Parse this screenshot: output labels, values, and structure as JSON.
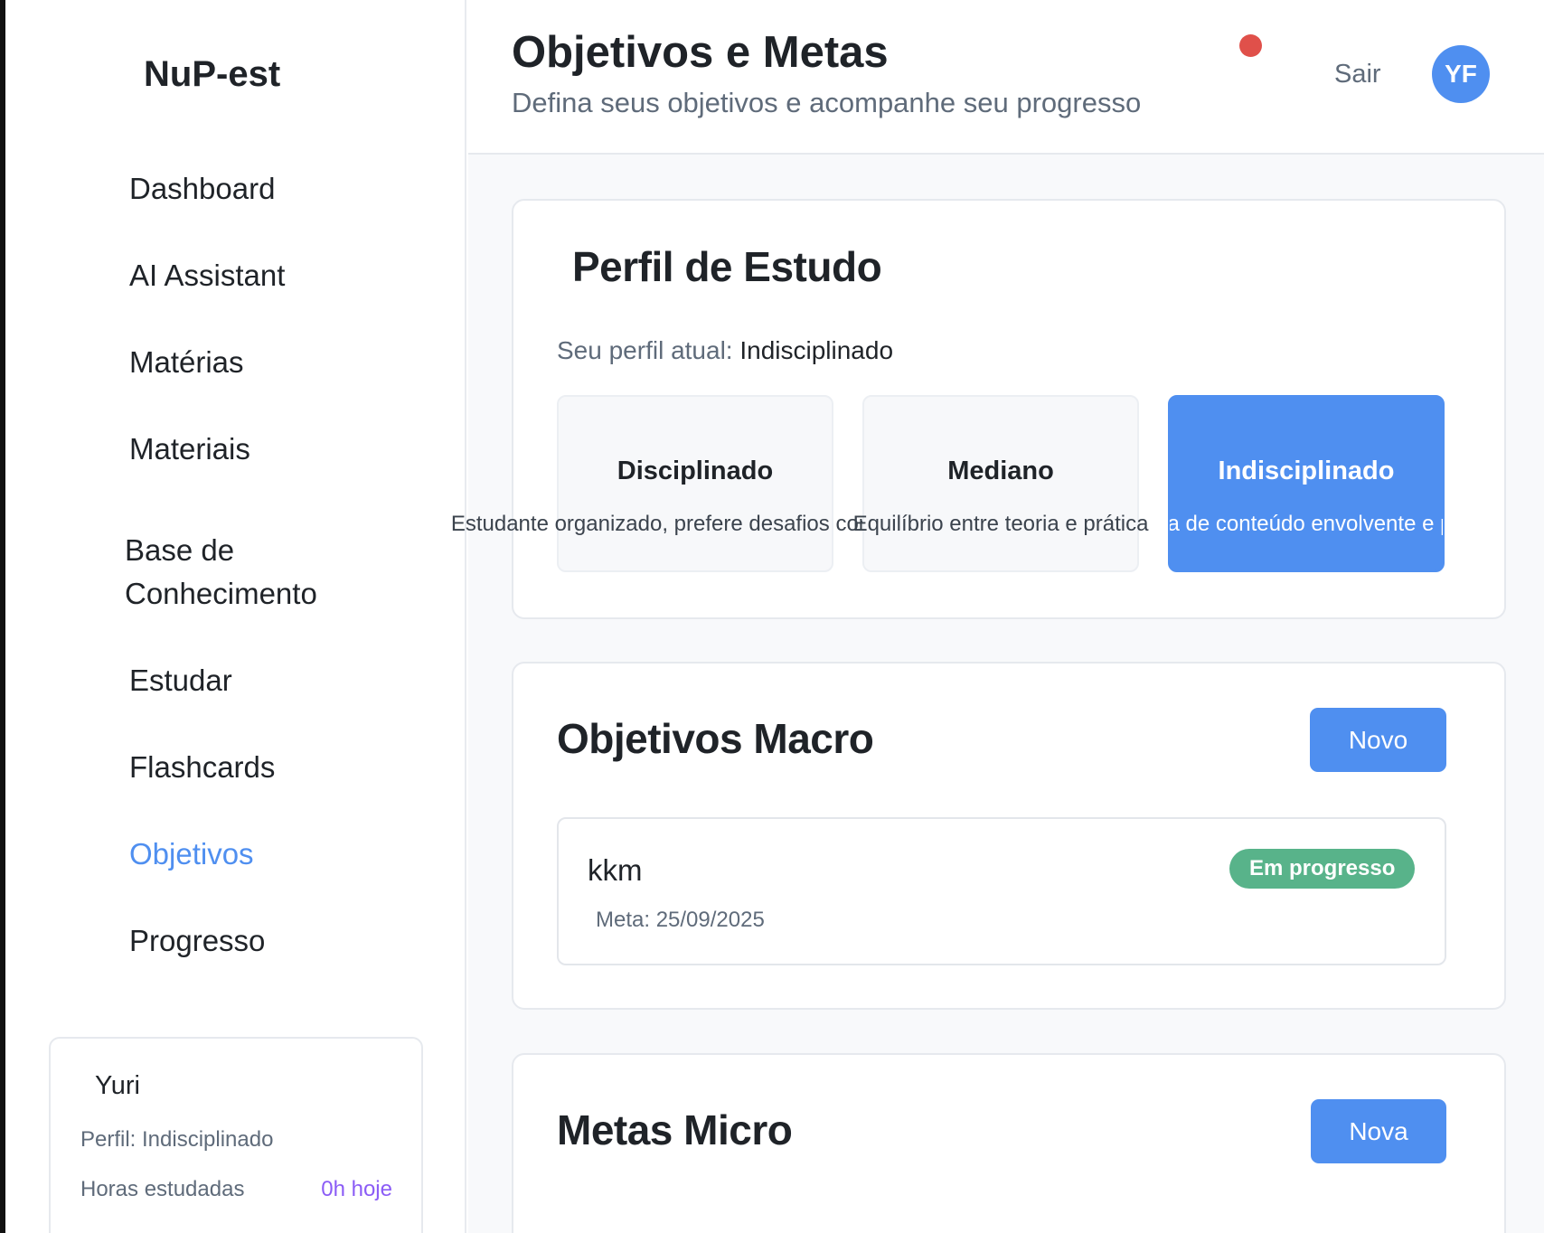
{
  "sidebar": {
    "brand": "NuP-est",
    "items": [
      {
        "label": "Dashboard",
        "active": false
      },
      {
        "label": "AI Assistant",
        "active": false
      },
      {
        "label": "Matérias",
        "active": false
      },
      {
        "label": "Materiais",
        "active": false
      },
      {
        "label": "Base de Conhecimento",
        "active": false
      },
      {
        "label": "Estudar",
        "active": false
      },
      {
        "label": "Flashcards",
        "active": false
      },
      {
        "label": "Objetivos",
        "active": true
      },
      {
        "label": "Progresso",
        "active": false
      }
    ],
    "user": {
      "name": "Yuri",
      "profile": "Perfil: Indisciplinado",
      "hours_label": "Horas estudadas",
      "hours_value": "0h hoje"
    }
  },
  "header": {
    "title": "Objetivos e Metas",
    "subtitle": "Defina seus objetivos e acompanhe seu progresso",
    "logout_label": "Sair",
    "avatar_initials": "YF"
  },
  "profile_section": {
    "title": "Perfil de Estudo",
    "current_label": "Seu perfil atual:",
    "current_value": "Indisciplinado",
    "options": [
      {
        "title": "Disciplinado",
        "description": "Estudante organizado, prefere desafios complexos",
        "selected": false
      },
      {
        "title": "Mediano",
        "description": "Equilíbrio entre teoria e prática",
        "selected": false
      },
      {
        "title": "Indisciplinado",
        "description": "Precisa de conteúdo envolvente e prático",
        "selected": true
      }
    ]
  },
  "macro_section": {
    "title": "Objetivos Macro",
    "new_label": "Novo",
    "goals": [
      {
        "title": "kkm",
        "date": "Meta: 25/09/2025",
        "status": "Em progresso"
      }
    ]
  },
  "micro_section": {
    "title": "Metas Micro",
    "new_label": "Nova"
  },
  "colors": {
    "accent": "#4f8ff0",
    "status_in_progress": "#58b38a",
    "notification": "#e0504a",
    "hours_highlight": "#8b5cf6"
  }
}
